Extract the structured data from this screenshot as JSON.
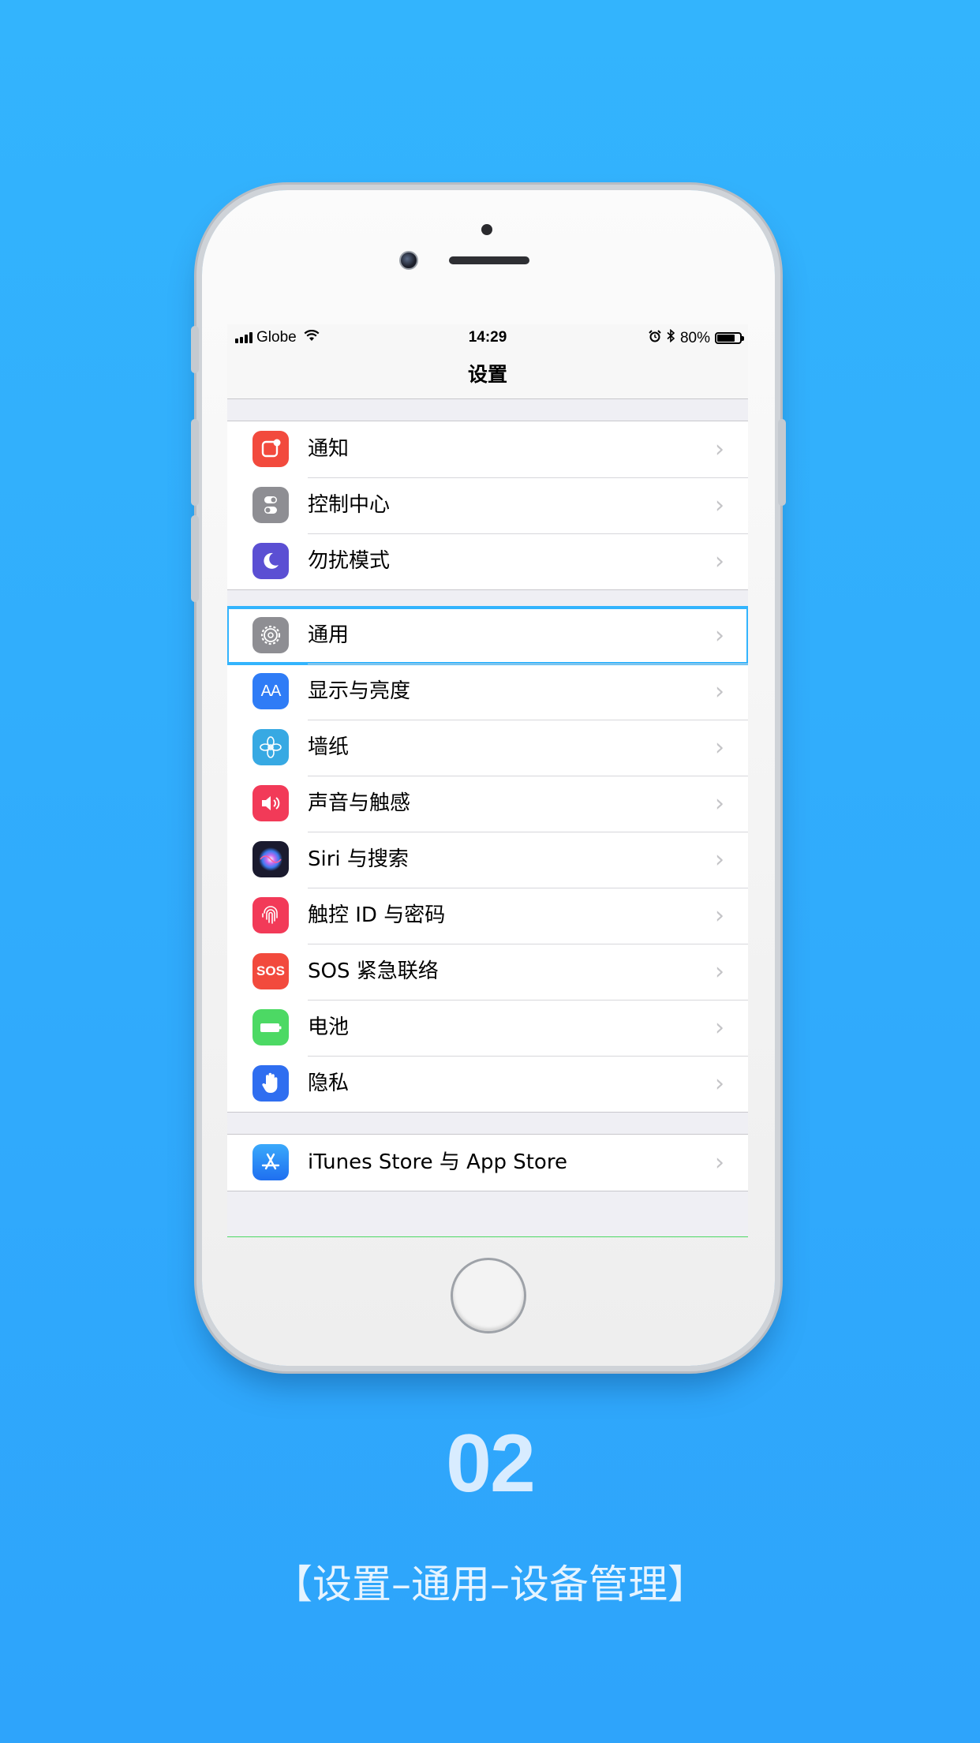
{
  "status_bar": {
    "carrier": "Globe",
    "time": "14:29",
    "battery_percent": "80%",
    "battery_level": 0.8,
    "icons": [
      "signal-icon",
      "wifi-icon",
      "alarm-icon",
      "bluetooth-icon",
      "battery-icon"
    ]
  },
  "nav": {
    "title": "设置"
  },
  "groups": [
    {
      "rows": [
        {
          "label": "通知",
          "icon": "notifications-icon",
          "color": "#f24a3d"
        },
        {
          "label": "控制中心",
          "icon": "control-center-icon",
          "color": "#8e8e93"
        },
        {
          "label": "勿扰模式",
          "icon": "moon-icon",
          "color": "#5b4fd3"
        }
      ]
    },
    {
      "rows": [
        {
          "label": "通用",
          "icon": "gear-icon",
          "color": "#8e8e93",
          "highlighted": true
        },
        {
          "label": "显示与亮度",
          "icon": "display-brightness-icon",
          "color": "#2f7cf6",
          "glyph": "AA"
        },
        {
          "label": "墙纸",
          "icon": "wallpaper-flower-icon",
          "color": "#37a9e3"
        },
        {
          "label": "声音与触感",
          "icon": "speaker-icon",
          "color": "#f23a58"
        },
        {
          "label": "Siri 与搜索",
          "icon": "siri-icon",
          "color": "#1a1a2e"
        },
        {
          "label": "触控 ID 与密码",
          "icon": "fingerprint-icon",
          "color": "#f23a58"
        },
        {
          "label": "SOS 紧急联络",
          "icon": "sos-icon",
          "color": "#f24a3d",
          "glyph": "SOS"
        },
        {
          "label": "电池",
          "icon": "battery-icon",
          "color": "#4cd964"
        },
        {
          "label": "隐私",
          "icon": "hand-icon",
          "color": "#2f6ef0"
        }
      ]
    },
    {
      "rows": [
        {
          "label": "iTunes Store 与 App Store",
          "icon": "app-store-icon",
          "color": "#2f8af6"
        }
      ]
    }
  ],
  "caption": {
    "step_number": "02",
    "path": "【设置–通用–设备管理】"
  },
  "colors": {
    "background": "#33b4fd",
    "highlight": "#33b4fd"
  }
}
